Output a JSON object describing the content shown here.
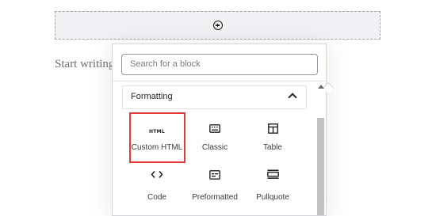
{
  "editor": {
    "placeholder": "Start writing"
  },
  "inserter": {
    "search": {
      "placeholder": "Search for a block",
      "value": ""
    },
    "panel": {
      "title": "Formatting",
      "expanded": true
    },
    "blocks": [
      {
        "label": "Custom HTML",
        "icon": "html-icon",
        "highlighted": true
      },
      {
        "label": "Classic",
        "icon": "keyboard-icon"
      },
      {
        "label": "Table",
        "icon": "table-icon"
      },
      {
        "label": "Code",
        "icon": "code-icon"
      },
      {
        "label": "Preformatted",
        "icon": "preformatted-icon"
      },
      {
        "label": "Pullquote",
        "icon": "pullquote-icon"
      }
    ],
    "html_icon_text": "HTML"
  },
  "colors": {
    "highlight": "#e33a3a",
    "appender_bg": "#f1f1f3"
  }
}
